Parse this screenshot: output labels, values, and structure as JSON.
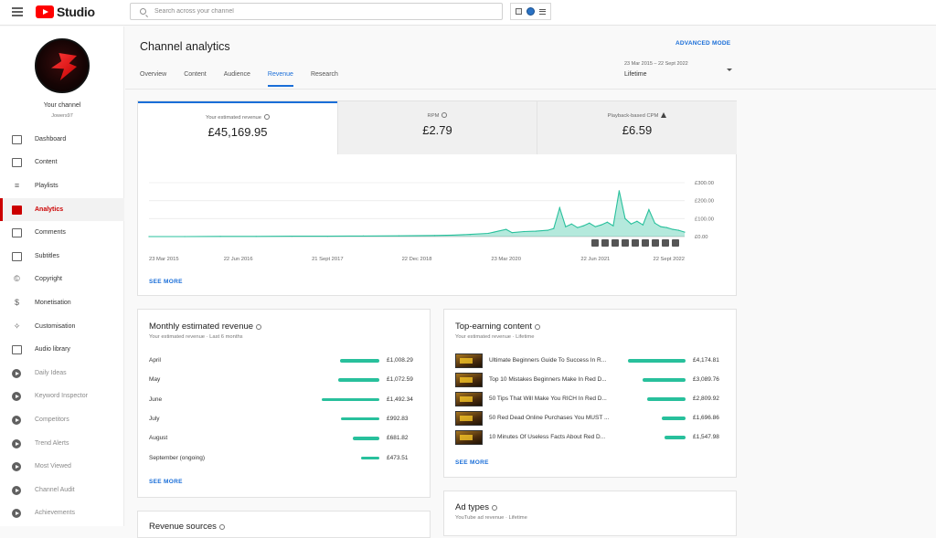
{
  "app": {
    "logo_text": "Studio",
    "search_placeholder": "Search across your channel"
  },
  "sidebar": {
    "channel_label": "Your channel",
    "channel_handle": "Jowers97",
    "items": [
      {
        "label": "Dashboard",
        "icon": "dashboard-icon"
      },
      {
        "label": "Content",
        "icon": "content-icon"
      },
      {
        "label": "Playlists",
        "icon": "playlists-icon"
      },
      {
        "label": "Analytics",
        "icon": "analytics-icon",
        "active": true
      },
      {
        "label": "Comments",
        "icon": "comments-icon"
      },
      {
        "label": "Subtitles",
        "icon": "subtitles-icon"
      },
      {
        "label": "Copyright",
        "icon": "copyright-icon"
      },
      {
        "label": "Monetisation",
        "icon": "dollar-icon"
      },
      {
        "label": "Customisation",
        "icon": "magic-wand-icon"
      },
      {
        "label": "Audio library",
        "icon": "audio-library-icon"
      },
      {
        "label": "Daily Ideas",
        "icon": "extension-icon"
      },
      {
        "label": "Keyword Inspector",
        "icon": "extension-icon"
      },
      {
        "label": "Competitors",
        "icon": "extension-icon"
      },
      {
        "label": "Trend Alerts",
        "icon": "extension-icon"
      },
      {
        "label": "Most Viewed",
        "icon": "extension-icon"
      },
      {
        "label": "Channel Audit",
        "icon": "extension-icon"
      },
      {
        "label": "Achievements",
        "icon": "extension-icon"
      }
    ]
  },
  "header": {
    "title": "Channel analytics",
    "advanced_mode": "ADVANCED MODE",
    "tabs": [
      "Overview",
      "Content",
      "Audience",
      "Revenue",
      "Research"
    ],
    "active_tab": "Revenue",
    "date_range": "23 Mar 2015 – 22 Sept 2022",
    "date_selection": "Lifetime"
  },
  "metrics": [
    {
      "label": "Your estimated revenue",
      "value": "£45,169.95"
    },
    {
      "label": "RPM",
      "value": "£2.79"
    },
    {
      "label": "Playback-based CPM",
      "value": "£6.59"
    }
  ],
  "chart_data": {
    "type": "line",
    "x_tick_labels": [
      "23 Mar 2015",
      "22 Jun 2016",
      "21 Sept 2017",
      "22 Dec 2018",
      "23 Mar 2020",
      "22 Jun 2021",
      "22 Sept 2022"
    ],
    "y_tick_labels": [
      "£300.00",
      "£200.00",
      "£100.00",
      "£0.00"
    ],
    "ylim": [
      0,
      300
    ],
    "color": "#28c09c",
    "x": [
      "2015-03",
      "2015-09",
      "2016-03",
      "2016-09",
      "2017-03",
      "2017-09",
      "2018-03",
      "2018-09",
      "2019-03",
      "2019-06",
      "2019-09",
      "2019-12",
      "2020-01",
      "2020-03",
      "2020-04",
      "2020-06",
      "2020-08",
      "2020-10",
      "2020-11",
      "2020-12",
      "2021-01",
      "2021-02",
      "2021-03",
      "2021-04",
      "2021-05",
      "2021-06",
      "2021-07",
      "2021-08",
      "2021-09",
      "2021-10",
      "2021-11",
      "2021-12",
      "2022-01",
      "2022-02",
      "2022-03",
      "2022-04",
      "2022-05",
      "2022-06",
      "2022-07",
      "2022-08",
      "2022-09"
    ],
    "values": [
      0,
      0,
      1,
      1,
      2,
      2,
      3,
      4,
      6,
      8,
      12,
      18,
      25,
      40,
      22,
      28,
      30,
      35,
      45,
      160,
      55,
      70,
      50,
      60,
      75,
      55,
      65,
      80,
      60,
      255,
      100,
      70,
      85,
      65,
      150,
      75,
      55,
      50,
      40,
      35,
      25
    ]
  },
  "see_more": "SEE MORE",
  "monthly": {
    "title": "Monthly estimated revenue",
    "subtitle": "Your estimated revenue · Last 6 months",
    "rows": [
      {
        "label": "April",
        "value": "£1,008.29",
        "amount": 1008.29
      },
      {
        "label": "May",
        "value": "£1,072.59",
        "amount": 1072.59
      },
      {
        "label": "June",
        "value": "£1,492.34",
        "amount": 1492.34
      },
      {
        "label": "July",
        "value": "£992.83",
        "amount": 992.83
      },
      {
        "label": "August",
        "value": "£681.82",
        "amount": 681.82
      },
      {
        "label": "September (ongoing)",
        "value": "£473.51",
        "amount": 473.51
      }
    ]
  },
  "top_content": {
    "title": "Top-earning content",
    "subtitle": "Your estimated revenue · Lifetime",
    "rows": [
      {
        "title": "Ultimate Beginners Guide To Success In R...",
        "value": "£4,174.81",
        "amount": 4174.81
      },
      {
        "title": "Top 10 Mistakes Beginners Make In Red D...",
        "value": "£3,089.76",
        "amount": 3089.76
      },
      {
        "title": "50 Tips That Will Make You RICH In Red D...",
        "value": "£2,809.92",
        "amount": 2809.92
      },
      {
        "title": "50 Red Dead Online Purchases You MUST ...",
        "value": "£1,696.86",
        "amount": 1696.86
      },
      {
        "title": "10 Minutes Of Useless Facts About Red D...",
        "value": "£1,547.98",
        "amount": 1547.98
      }
    ]
  },
  "ad_types": {
    "title": "Ad types",
    "subtitle": "YouTube ad revenue · Lifetime"
  },
  "revenue_sources": {
    "title": "Revenue sources"
  }
}
